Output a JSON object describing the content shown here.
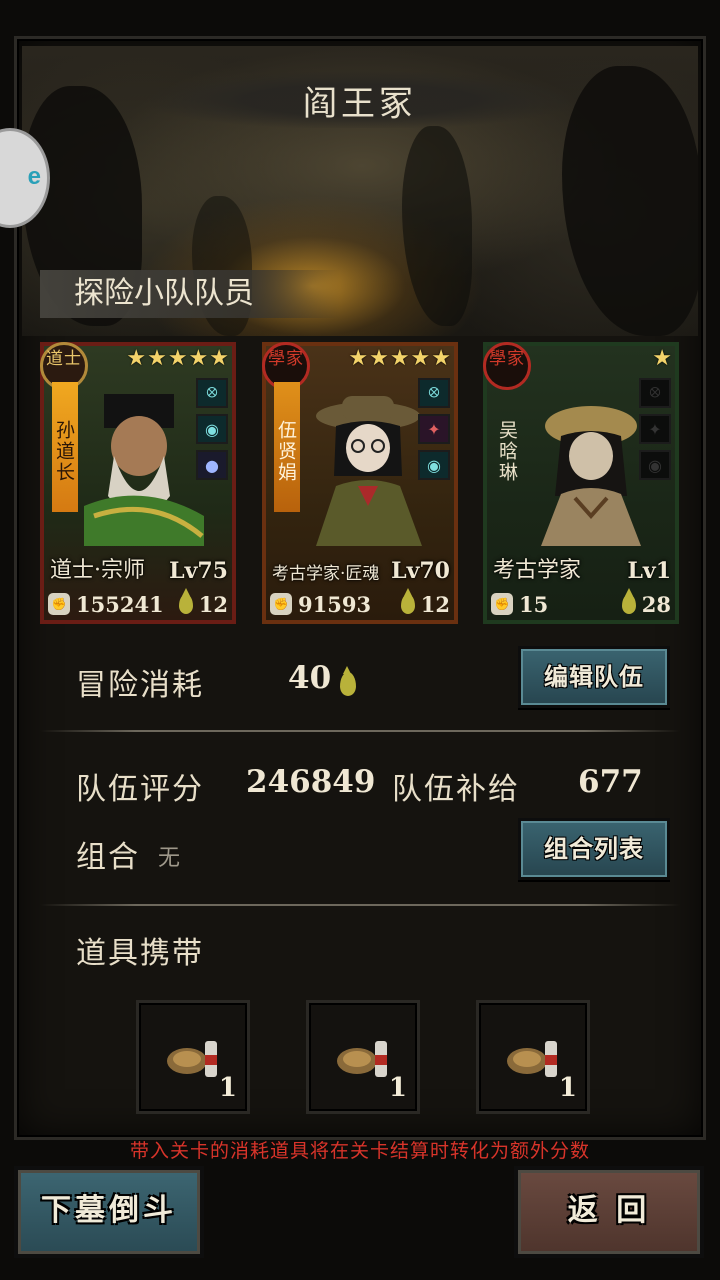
{
  "header": {
    "title": "阎王冢"
  },
  "side_bubble": {
    "text": "e"
  },
  "team_section": {
    "label": "探险小队队员"
  },
  "members": [
    {
      "badge": "道士",
      "name": "孙道长",
      "stars": "★★★★★",
      "star_count": 5,
      "class_name": "道士·宗师",
      "level": "Lv75",
      "power": "155241",
      "supply": "12",
      "items": [
        "hook-icon",
        "orb-icon",
        "pearl-icon"
      ]
    },
    {
      "badge": "學家",
      "name": "伍贤娟",
      "stars": "★★★★★",
      "star_count": 5,
      "class_name": "考古学家·匠魂",
      "level": "Lv70",
      "power": "91593",
      "supply": "12",
      "items": [
        "hook-icon",
        "blade-icon",
        "orb-icon"
      ]
    },
    {
      "badge": "學家",
      "name": "吴晗琳",
      "stars": "★",
      "star_count": 1,
      "class_name": "考古学家",
      "level": "Lv1",
      "power": "15",
      "supply": "28",
      "items": [
        "hook-icon",
        "blade-icon",
        "orb-icon"
      ]
    }
  ],
  "adventure": {
    "label": "冒险消耗",
    "cost": "40",
    "edit_button": "编辑队伍"
  },
  "team_stats": {
    "score_label": "队伍评分",
    "score": "246849",
    "supply_label": "队伍补给",
    "supply": "677"
  },
  "combo": {
    "label": "组合",
    "value": "无",
    "list_button": "组合列表"
  },
  "items_section": {
    "label": "道具携带",
    "slots": [
      {
        "count": "1"
      },
      {
        "count": "1"
      },
      {
        "count": "1"
      }
    ]
  },
  "notice": "带入关卡的消耗道具将在关卡结算时转化为额外分数",
  "actions": {
    "start": "下墓倒斗",
    "back": "返 回"
  },
  "colors": {
    "accent_teal": "#3a6470",
    "back_brown": "#6a4a40",
    "notice_red": "#d8342a",
    "star_gold": "#f3d36a"
  }
}
